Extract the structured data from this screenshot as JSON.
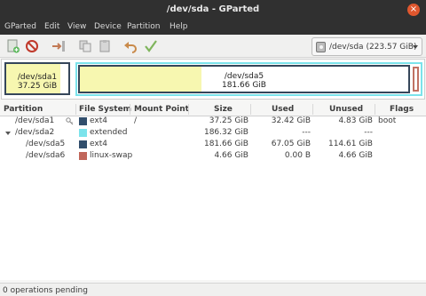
{
  "window": {
    "title": "/dev/sda - GParted"
  },
  "menu": [
    "GParted",
    "Edit",
    "View",
    "Device",
    "Partition",
    "Help"
  ],
  "device_selector": {
    "label": "/dev/sda",
    "size": "(223.57 GiB)"
  },
  "partition_map": {
    "sda1": {
      "name": "/dev/sda1",
      "size": "37.25 GiB",
      "used_fraction": 0.87
    },
    "sda5": {
      "name": "/dev/sda5",
      "size": "181.66 GiB",
      "used_fraction": 0.37
    }
  },
  "columns": [
    "Partition",
    "File System",
    "Mount Point",
    "Size",
    "Used",
    "Unused",
    "Flags"
  ],
  "rows": [
    {
      "partition": "/dev/sda1",
      "fs": "ext4",
      "fs_color": "#314e6c",
      "mount": "/",
      "size": "37.25 GiB",
      "used": "32.42 GiB",
      "unused": "4.83 GiB",
      "flags": "boot"
    },
    {
      "partition": "/dev/sda2",
      "fs": "extended",
      "fs_color": "#7be3eb",
      "mount": "",
      "size": "186.32 GiB",
      "used": "---",
      "unused": "---",
      "flags": ""
    },
    {
      "partition": "/dev/sda5",
      "fs": "ext4",
      "fs_color": "#314e6c",
      "mount": "",
      "size": "181.66 GiB",
      "used": "67.05 GiB",
      "unused": "114.61 GiB",
      "flags": ""
    },
    {
      "partition": "/dev/sda6",
      "fs": "linux-swap",
      "fs_color": "#c1665a",
      "mount": "",
      "size": "4.66 GiB",
      "used": "0.00 B",
      "unused": "4.66 GiB",
      "flags": ""
    }
  ],
  "status": {
    "text": "0 operations pending"
  }
}
